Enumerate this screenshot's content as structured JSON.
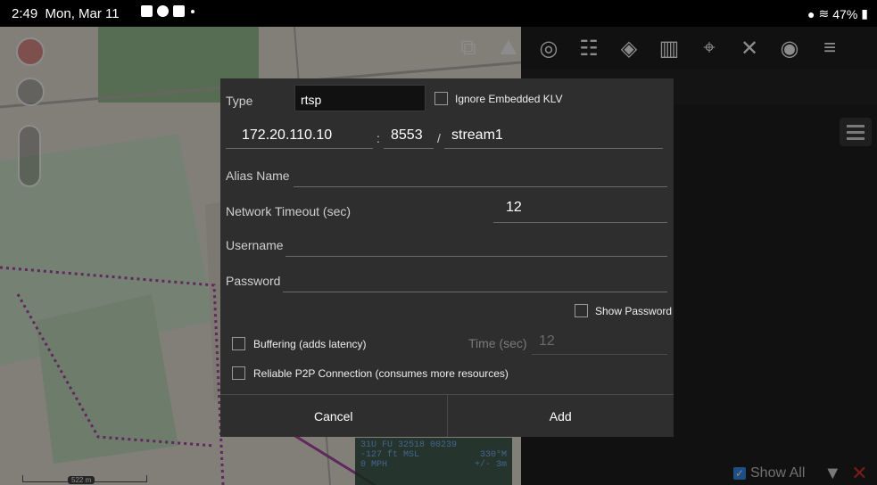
{
  "status_bar": {
    "time": "2:49",
    "date": "Mon, Mar 11",
    "battery": "47%"
  },
  "toolbar": {
    "icons": [
      "copy-icon",
      "terrain-icon",
      "globe-icon",
      "contacts-icon",
      "layers-icon",
      "map-icon",
      "add-location-icon",
      "tools-icon",
      "broadcast-icon",
      "menu-icon"
    ]
  },
  "map_overlay": {
    "mgrs": "31U FU 32518 00239",
    "altitude": "-127 ft MSL",
    "bearing": "330°M",
    "speed": "0 MPH",
    "accuracy": "+/- 3m",
    "scale": "522 m"
  },
  "right_pane": {
    "show_all_label": "Show All"
  },
  "dialog": {
    "type_label": "Type",
    "type_value": "rtsp",
    "ignore_klv_label": "Ignore Embedded KLV",
    "host": "172.20.110.10",
    "colon": ":",
    "port": "8553",
    "slash": "/",
    "path": "stream1",
    "alias_label": "Alias Name",
    "alias_value": "",
    "timeout_label": "Network Timeout (sec)",
    "timeout_value": "12",
    "username_label": "Username",
    "username_value": "",
    "password_label": "Password",
    "password_value": "",
    "show_password_label": "Show Password",
    "buffering_label": "Buffering (adds latency)",
    "time_label": "Time (sec)",
    "time_value": "12",
    "p2p_label": "Reliable P2P Connection (consumes more resources)",
    "cancel_label": "Cancel",
    "add_label": "Add"
  }
}
